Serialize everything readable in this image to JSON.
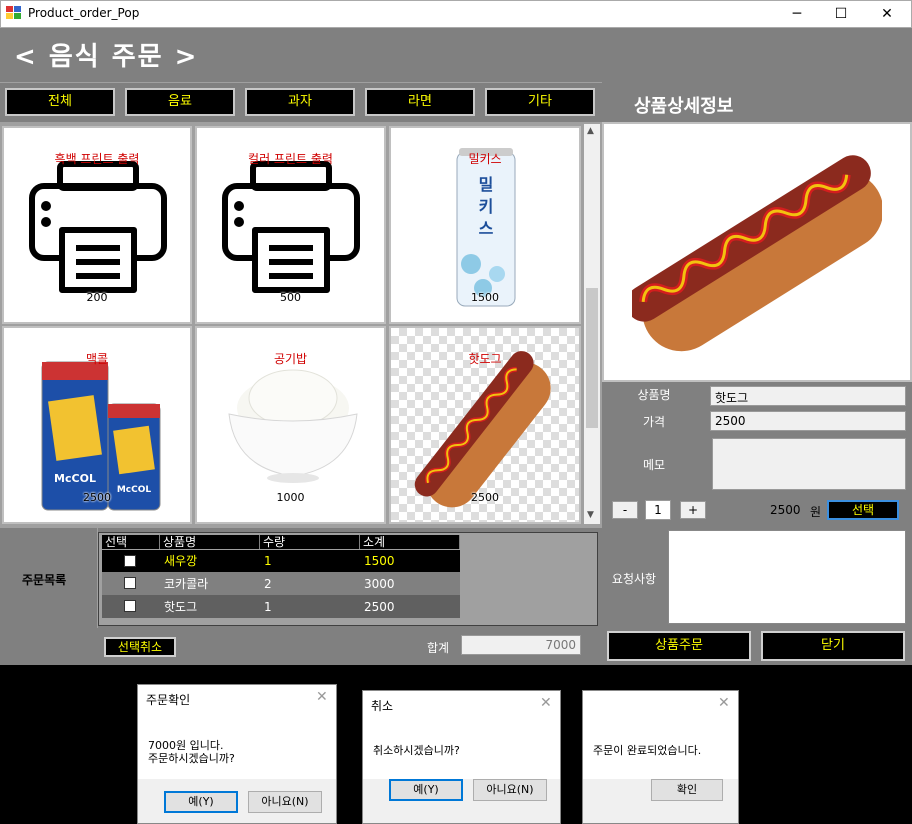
{
  "window": {
    "title": "Product_order_Pop",
    "min": "─",
    "max": "☐",
    "close": "✕"
  },
  "header": {
    "title": "< 음식 주문 >"
  },
  "categories": [
    "전체",
    "음료",
    "과자",
    "라면",
    "기타"
  ],
  "products": [
    {
      "name": "흑백 프린트 출력",
      "price": "200",
      "icon": "printer-icon"
    },
    {
      "name": "컬러 프린트 출력",
      "price": "500",
      "icon": "printer-icon"
    },
    {
      "name": "밀키스",
      "price": "1500",
      "icon": "drink-can-icon"
    },
    {
      "name": "맥콜",
      "price": "2500",
      "icon": "drink-cans-icon"
    },
    {
      "name": "공기밥",
      "price": "1000",
      "icon": "rice-bowl-icon"
    },
    {
      "name": "핫도그",
      "price": "2500",
      "icon": "hotdog-icon"
    }
  ],
  "detail": {
    "title": "상품상세정보",
    "name_label": "상품명",
    "name_value": "핫도그",
    "price_label": "가격",
    "price_value": "2500",
    "memo_label": "메모",
    "minus": "-",
    "qty": "1",
    "plus": "+",
    "total_price": "2500",
    "unit": "원",
    "select_label": "선택",
    "request_label": "요청사항",
    "order_label": "상품주문",
    "close_label": "닫기"
  },
  "order": {
    "label": "주문목록",
    "columns": [
      "선택",
      "상품명",
      "수량",
      "소계"
    ],
    "rows": [
      {
        "name": "새우깡",
        "qty": "1",
        "subtotal": "1500"
      },
      {
        "name": "코카콜라",
        "qty": "2",
        "subtotal": "3000"
      },
      {
        "name": "핫도그",
        "qty": "1",
        "subtotal": "2500"
      }
    ],
    "cancel_label": "선택취소",
    "sum_label": "합계",
    "sum_value": "7000"
  },
  "dialogs": [
    {
      "title": "주문확인",
      "line1": "7000원 입니다.",
      "line2": "주문하시겠습니까?",
      "yes": "예(Y)",
      "no": "아니요(N)"
    },
    {
      "title": "취소",
      "line1": "취소하시겠습니까?",
      "yes": "예(Y)",
      "no": "아니요(N)"
    },
    {
      "title": "",
      "line1": "주문이 완료되었습니다.",
      "ok": "확인"
    }
  ],
  "colors": {
    "accent": "#ffff00",
    "panel": "#808080",
    "product_name": "#d00000"
  }
}
